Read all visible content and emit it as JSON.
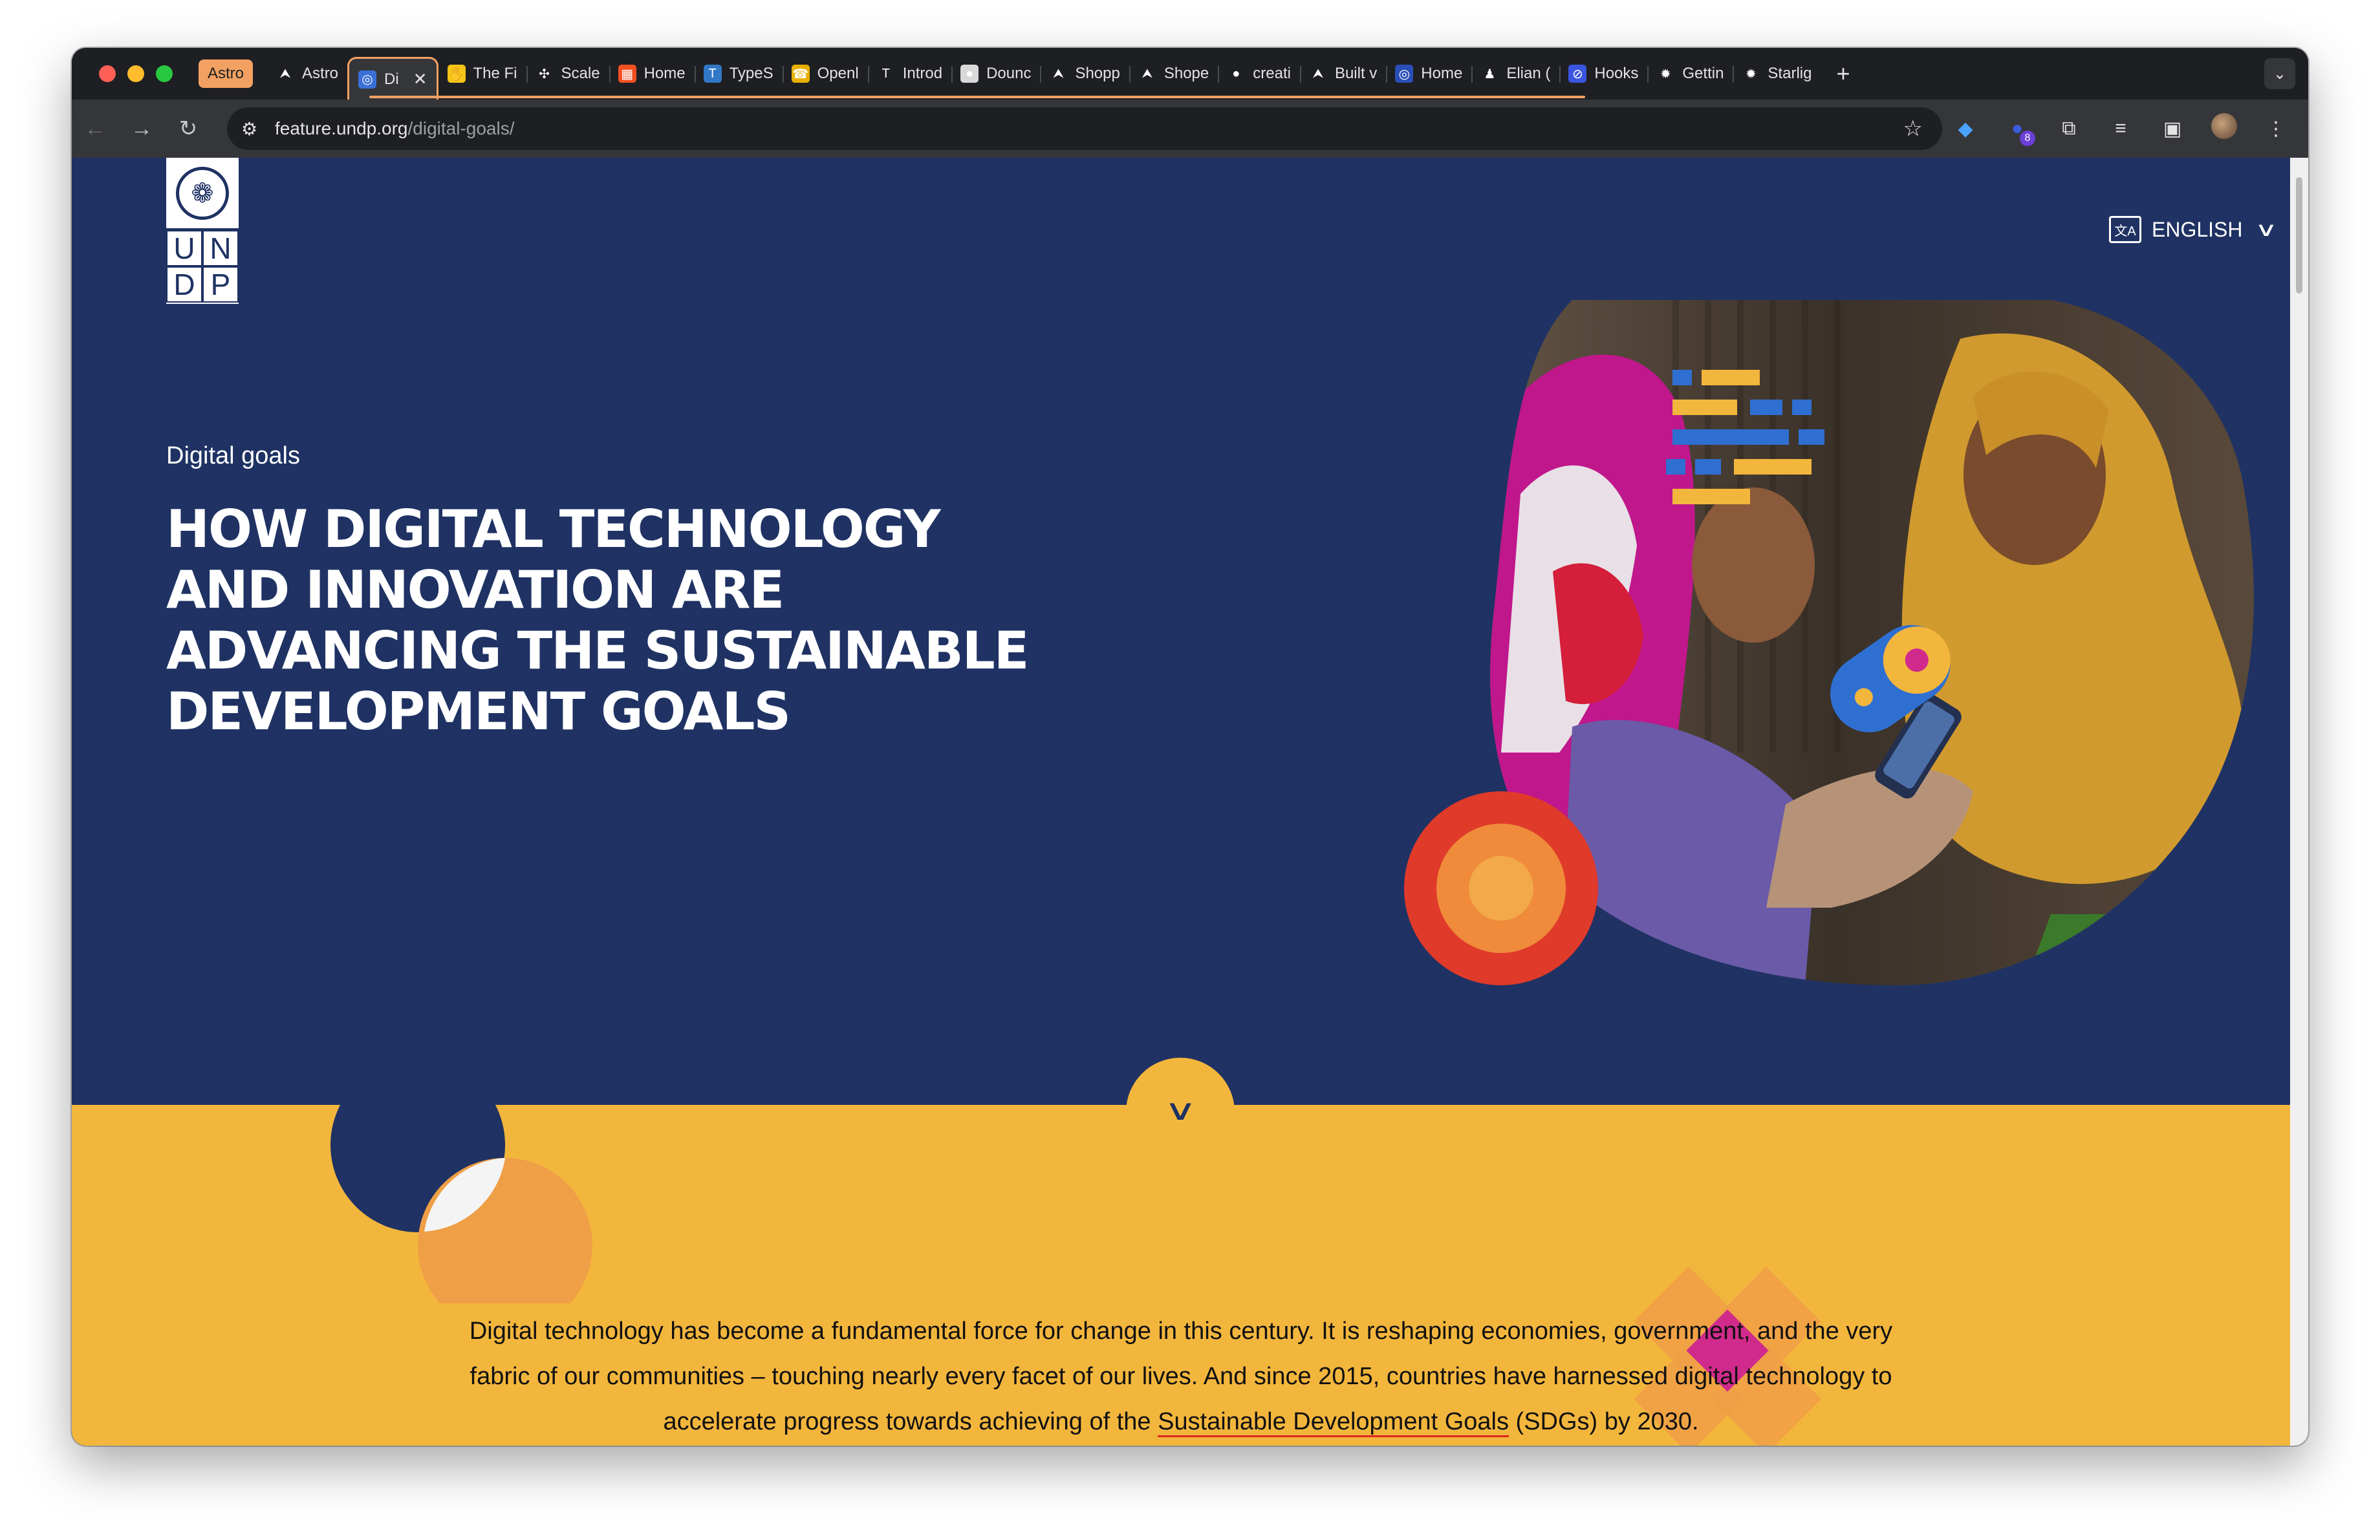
{
  "browser": {
    "tab_group_label": "Astro",
    "tabs": [
      {
        "label": "Astro",
        "icon": "rocket-icon",
        "color": "#1e1f22"
      },
      {
        "label": "Di",
        "icon": "undp-icon",
        "color": "#3a6fd8",
        "active": true
      },
      {
        "label": "The Fi",
        "icon": "hand-icon",
        "color": "#f5c518"
      },
      {
        "label": "Scale",
        "icon": "sparkle-icon",
        "color": "#1e1f22"
      },
      {
        "label": "Home",
        "icon": "windows-icon",
        "color": "#f25022"
      },
      {
        "label": "TypeS",
        "icon": "typescript-icon",
        "color": "#3178c6"
      },
      {
        "label": "Openl",
        "icon": "phone-icon",
        "color": "#e8b000"
      },
      {
        "label": "Introd",
        "icon": "ts-icon",
        "color": "#1e1f22"
      },
      {
        "label": "Dounc",
        "icon": "circle-icon",
        "color": "#d9d9d9"
      },
      {
        "label": "Shopp",
        "icon": "rocket-icon",
        "color": "#1e1f22"
      },
      {
        "label": "Shope",
        "icon": "rocket-icon",
        "color": "#1e1f22"
      },
      {
        "label": "creati",
        "icon": "github-icon",
        "color": "#1e1f22"
      },
      {
        "label": "Built v",
        "icon": "rocket-icon",
        "color": "#1e1f22"
      },
      {
        "label": "Home",
        "icon": "globe-icon",
        "color": "#2a4fb8"
      },
      {
        "label": "Elian (",
        "icon": "person-icon",
        "color": "#1e1f22"
      },
      {
        "label": "Hooks",
        "icon": "hook-icon",
        "color": "#3a55e0"
      },
      {
        "label": "Gettin",
        "icon": "sun-icon",
        "color": "#1e1f22"
      },
      {
        "label": "Starlig",
        "icon": "sun-icon",
        "color": "#1e1f22"
      }
    ],
    "url_host": "feature.undp.org",
    "url_path": "/digital-goals/",
    "extension_badge": "8"
  },
  "page": {
    "logo_letters": [
      "U",
      "N",
      "D",
      "P"
    ],
    "language_label": "ENGLISH",
    "eyebrow": "Digital goals",
    "headline_lines": [
      "HOW DIGITAL TECHNOLOGY",
      "AND INNOVATION ARE",
      "ADVANCING THE SUSTAINABLE",
      "DEVELOPMENT GOALS"
    ],
    "intro_before_link": "Digital technology has become a fundamental force for change in this century. It is reshaping economies, government, and the very fabric of our communities – touching nearly every facet of our lives. And since 2015, countries have harnessed digital technology to accelerate progress towards achieving of the",
    "intro_link": "Sustainable Development Goals",
    "intro_after_link": "(SDGs) by 2030.",
    "colors": {
      "navy": "#1f3263",
      "yellow": "#f3b63d",
      "orange": "#ef9b3f",
      "red": "#e1261c",
      "magenta": "#d02a8c"
    }
  }
}
